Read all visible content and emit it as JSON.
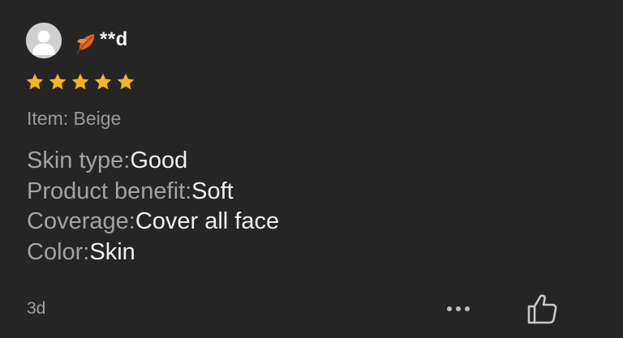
{
  "review": {
    "avatar_icon": "user-silhouette-icon",
    "badge_icon": "autumn-leaf-icon",
    "username": "**d",
    "rating": 5,
    "rating_max": 5,
    "star_color": "#f6b51e",
    "item": "Item: Beige",
    "attributes": [
      {
        "key": "Skin type:",
        "value": "Good"
      },
      {
        "key": "Product benefit:",
        "value": "Soft"
      },
      {
        "key": "Coverage:",
        "value": "Cover all face"
      },
      {
        "key": "Color:",
        "value": "Skin"
      }
    ],
    "age": "3d",
    "more_icon": "more-dots-icon",
    "like_icon": "thumbs-up-icon"
  }
}
